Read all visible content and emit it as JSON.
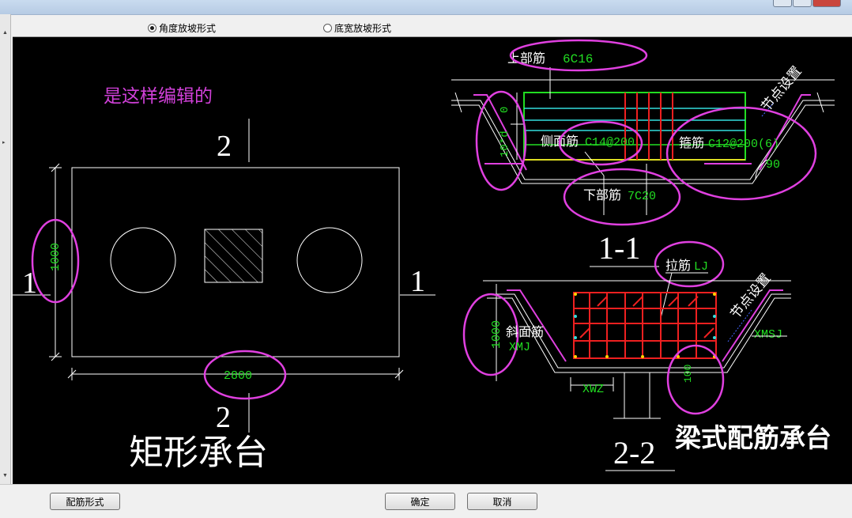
{
  "options": {
    "angle_label": "角度放坡形式",
    "angle_selected": true,
    "width_label": "底宽放坡形式",
    "width_selected": false
  },
  "left_drawing": {
    "note": "是这样编辑的",
    "section_mark_2": "2",
    "section_mark_1": "1",
    "dim_height": "1000",
    "dim_width": "2800",
    "caption": "矩形承台"
  },
  "section_1_1": {
    "top_bar_label": "上部筋",
    "top_bar_value": "6C16",
    "dim_zero": "0",
    "dim_10d": "10*d",
    "side_bar_label": "侧面筋",
    "side_bar_value": "C14@200",
    "stirrup_label": "箍筋",
    "stirrup_value": "C12@200(6)",
    "angle_value": "90",
    "bottom_bar_label": "下部筋",
    "bottom_bar_value": "7C20",
    "node_label": "节点设置",
    "title": "1-1"
  },
  "section_2_2": {
    "tie_label": "拉筋",
    "tie_value": "LJ",
    "node_label": "节点设置",
    "slope_bar_label": "斜面筋",
    "slope_bar_value": "XMJ",
    "dim_height": "1000",
    "xmsj": "XMSJ",
    "xwz": "XWZ",
    "dim_100": "100",
    "title": "2-2",
    "caption": "梁式配筋承台"
  },
  "colors": {
    "canvas_bg": "#000000",
    "highlight": "#e040e0",
    "rebar_green": "#22dd22",
    "rebar_red": "#ee2020",
    "dim_text": "#22dd22",
    "line_white": "#ffffff"
  },
  "buttons": {
    "rebar_form": "配筋形式",
    "ok": "确定",
    "cancel": "取消"
  }
}
